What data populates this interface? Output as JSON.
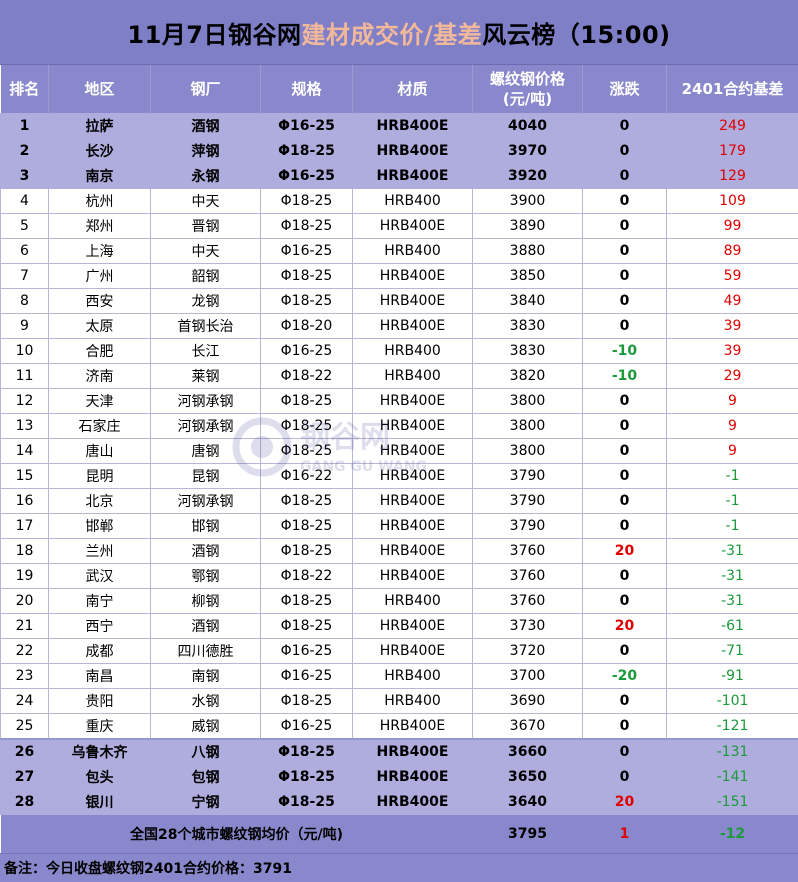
{
  "title": {
    "part1": "11月7日钢谷网",
    "highlight": "建材成交价/基差",
    "part2": "风云榜（15:00)"
  },
  "headers": [
    "排名",
    "地区",
    "钢厂",
    "规格",
    "材质",
    "螺纹钢价格\n(元/吨)",
    "涨跌",
    "2401合约基差"
  ],
  "rows": [
    {
      "rank": "1",
      "region": "拉萨",
      "mill": "酒钢",
      "spec": "Φ16-25",
      "grade": "HRB400E",
      "price": "4040",
      "change": "0",
      "basis": "249",
      "hl": true
    },
    {
      "rank": "2",
      "region": "长沙",
      "mill": "萍钢",
      "spec": "Φ18-25",
      "grade": "HRB400E",
      "price": "3970",
      "change": "0",
      "basis": "179",
      "hl": true
    },
    {
      "rank": "3",
      "region": "南京",
      "mill": "永钢",
      "spec": "Φ16-25",
      "grade": "HRB400E",
      "price": "3920",
      "change": "0",
      "basis": "129",
      "hl": true
    },
    {
      "rank": "4",
      "region": "杭州",
      "mill": "中天",
      "spec": "Φ18-25",
      "grade": "HRB400",
      "price": "3900",
      "change": "0",
      "basis": "109"
    },
    {
      "rank": "5",
      "region": "郑州",
      "mill": "晋钢",
      "spec": "Φ18-25",
      "grade": "HRB400E",
      "price": "3890",
      "change": "0",
      "basis": "99"
    },
    {
      "rank": "6",
      "region": "上海",
      "mill": "中天",
      "spec": "Φ16-25",
      "grade": "HRB400",
      "price": "3880",
      "change": "0",
      "basis": "89"
    },
    {
      "rank": "7",
      "region": "广州",
      "mill": "韶钢",
      "spec": "Φ18-25",
      "grade": "HRB400E",
      "price": "3850",
      "change": "0",
      "basis": "59"
    },
    {
      "rank": "8",
      "region": "西安",
      "mill": "龙钢",
      "spec": "Φ18-25",
      "grade": "HRB400E",
      "price": "3840",
      "change": "0",
      "basis": "49"
    },
    {
      "rank": "9",
      "region": "太原",
      "mill": "首钢长治",
      "spec": "Φ18-20",
      "grade": "HRB400E",
      "price": "3830",
      "change": "0",
      "basis": "39"
    },
    {
      "rank": "10",
      "region": "合肥",
      "mill": "长江",
      "spec": "Φ16-25",
      "grade": "HRB400",
      "price": "3830",
      "change": "-10",
      "basis": "39"
    },
    {
      "rank": "11",
      "region": "济南",
      "mill": "莱钢",
      "spec": "Φ18-22",
      "grade": "HRB400",
      "price": "3820",
      "change": "-10",
      "basis": "29"
    },
    {
      "rank": "12",
      "region": "天津",
      "mill": "河钢承钢",
      "spec": "Φ18-25",
      "grade": "HRB400E",
      "price": "3800",
      "change": "0",
      "basis": "9"
    },
    {
      "rank": "13",
      "region": "石家庄",
      "mill": "河钢承钢",
      "spec": "Φ18-25",
      "grade": "HRB400E",
      "price": "3800",
      "change": "0",
      "basis": "9"
    },
    {
      "rank": "14",
      "region": "唐山",
      "mill": "唐钢",
      "spec": "Φ18-25",
      "grade": "HRB400E",
      "price": "3800",
      "change": "0",
      "basis": "9"
    },
    {
      "rank": "15",
      "region": "昆明",
      "mill": "昆钢",
      "spec": "Φ16-22",
      "grade": "HRB400E",
      "price": "3790",
      "change": "0",
      "basis": "-1"
    },
    {
      "rank": "16",
      "region": "北京",
      "mill": "河钢承钢",
      "spec": "Φ18-25",
      "grade": "HRB400E",
      "price": "3790",
      "change": "0",
      "basis": "-1"
    },
    {
      "rank": "17",
      "region": "邯郸",
      "mill": "邯钢",
      "spec": "Φ18-25",
      "grade": "HRB400E",
      "price": "3790",
      "change": "0",
      "basis": "-1"
    },
    {
      "rank": "18",
      "region": "兰州",
      "mill": "酒钢",
      "spec": "Φ18-25",
      "grade": "HRB400E",
      "price": "3760",
      "change": "20",
      "basis": "-31"
    },
    {
      "rank": "19",
      "region": "武汉",
      "mill": "鄂钢",
      "spec": "Φ18-22",
      "grade": "HRB400E",
      "price": "3760",
      "change": "0",
      "basis": "-31"
    },
    {
      "rank": "20",
      "region": "南宁",
      "mill": "柳钢",
      "spec": "Φ18-25",
      "grade": "HRB400",
      "price": "3760",
      "change": "0",
      "basis": "-31"
    },
    {
      "rank": "21",
      "region": "西宁",
      "mill": "酒钢",
      "spec": "Φ18-25",
      "grade": "HRB400E",
      "price": "3730",
      "change": "20",
      "basis": "-61"
    },
    {
      "rank": "22",
      "region": "成都",
      "mill": "四川德胜",
      "spec": "Φ16-25",
      "grade": "HRB400E",
      "price": "3720",
      "change": "0",
      "basis": "-71"
    },
    {
      "rank": "23",
      "region": "南昌",
      "mill": "南钢",
      "spec": "Φ16-25",
      "grade": "HRB400",
      "price": "3700",
      "change": "-20",
      "basis": "-91"
    },
    {
      "rank": "24",
      "region": "贵阳",
      "mill": "水钢",
      "spec": "Φ18-25",
      "grade": "HRB400",
      "price": "3690",
      "change": "0",
      "basis": "-101"
    },
    {
      "rank": "25",
      "region": "重庆",
      "mill": "威钢",
      "spec": "Φ16-25",
      "grade": "HRB400E",
      "price": "3670",
      "change": "0",
      "basis": "-121"
    },
    {
      "rank": "26",
      "region": "乌鲁木齐",
      "mill": "八钢",
      "spec": "Φ18-25",
      "grade": "HRB400E",
      "price": "3660",
      "change": "0",
      "basis": "-131",
      "hl": true
    },
    {
      "rank": "27",
      "region": "包头",
      "mill": "包钢",
      "spec": "Φ18-25",
      "grade": "HRB400E",
      "price": "3650",
      "change": "0",
      "basis": "-141",
      "hl": true
    },
    {
      "rank": "28",
      "region": "银川",
      "mill": "宁钢",
      "spec": "Φ18-25",
      "grade": "HRB400E",
      "price": "3640",
      "change": "20",
      "basis": "-151",
      "hl": true
    }
  ],
  "summary": {
    "label": "全国28个城市螺纹钢均价（元/吨)",
    "price": "3795",
    "change": "1",
    "basis": "-12"
  },
  "note": "备注：今日收盘螺纹钢2401合约价格：3791",
  "watermark": {
    "cn": "钢谷网",
    "en": "GANG GU WANG"
  },
  "colors": {
    "up": "#e00000",
    "down": "#1a9a3a",
    "header": "#8a88cc",
    "highlight_row": "#afaddd",
    "title_accent": "#f2b89a"
  }
}
